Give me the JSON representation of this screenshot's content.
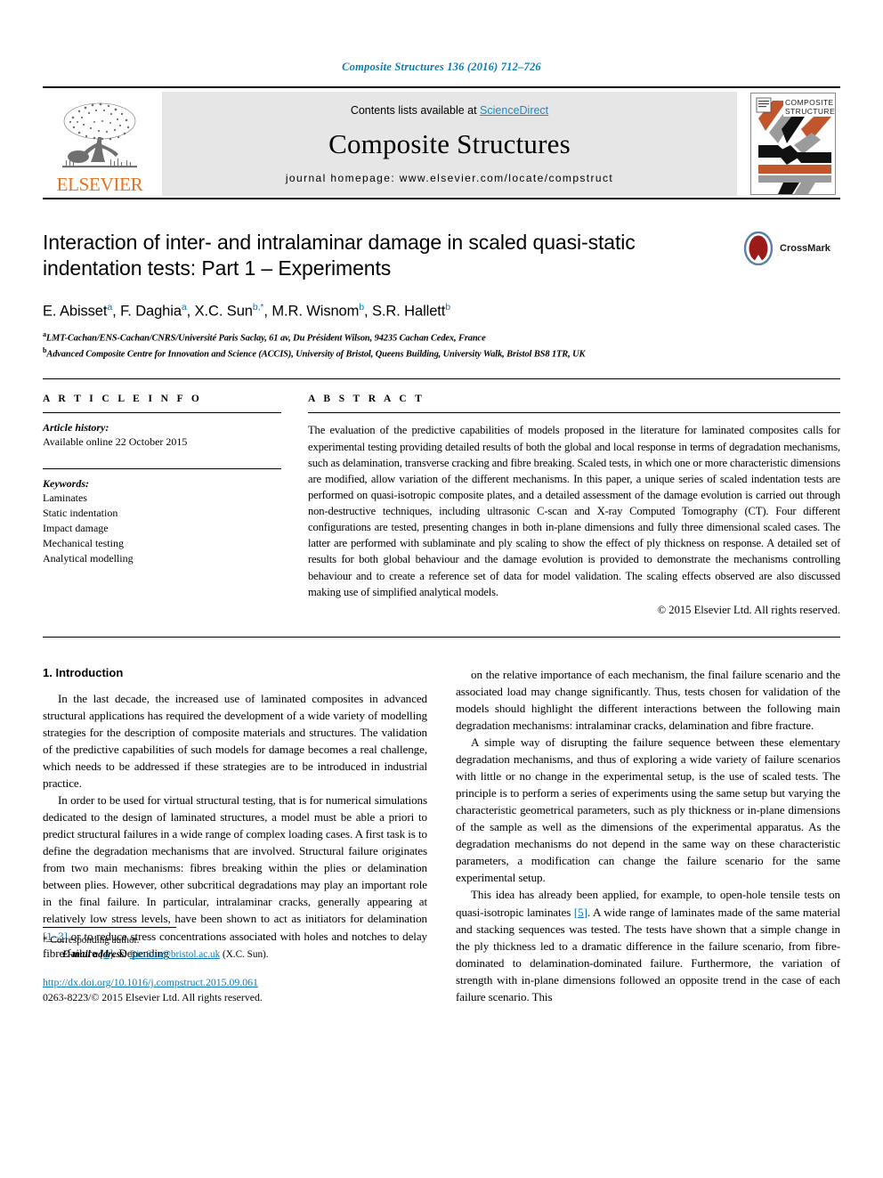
{
  "running_head": "Composite Structures 136 (2016) 712–726",
  "masthead": {
    "contents_prefix": "Contents lists available at ",
    "sciencedirect": "ScienceDirect",
    "journal_name": "Composite Structures",
    "homepage": "journal homepage: www.elsevier.com/locate/compstruct",
    "publisher_logo_text": "ELSEVIER",
    "cover_title_line1": "COMPOSITE",
    "cover_title_line2": "STRUCTURES"
  },
  "title": "Interaction of inter- and intralaminar damage in scaled quasi-static indentation tests: Part 1 – Experiments",
  "crossmark_label": "CrossMark",
  "authors": [
    {
      "name": "E. Abisset",
      "sup": "a",
      "sep": ", "
    },
    {
      "name": "F. Daghia",
      "sup": "a",
      "sep": ", "
    },
    {
      "name": "X.C. Sun",
      "sup": "b,*",
      "sep": ", "
    },
    {
      "name": "M.R. Wisnom",
      "sup": "b",
      "sep": ", "
    },
    {
      "name": "S.R. Hallett",
      "sup": "b",
      "sep": ""
    }
  ],
  "affiliations": [
    {
      "marker": "a",
      "text": "LMT-Cachan/ENS-Cachan/CNRS/Université Paris Saclay, 61 av, Du Président Wilson, 94235 Cachan Cedex, France"
    },
    {
      "marker": "b",
      "text": "Advanced Composite Centre for Innovation and Science (ACCIS), University of Bristol, Queens Building, University Walk, Bristol BS8 1TR, UK"
    }
  ],
  "article_info": {
    "heading": "A R T I C L E    I N F O",
    "history_label": "Article history:",
    "history_value": "Available online 22 October 2015",
    "keywords_label": "Keywords:",
    "keywords": [
      "Laminates",
      "Static indentation",
      "Impact damage",
      "Mechanical testing",
      "Analytical modelling"
    ]
  },
  "abstract": {
    "heading": "A B S T R A C T",
    "body": "The evaluation of the predictive capabilities of models proposed in the literature for laminated composites calls for experimental testing providing detailed results of both the global and local response in terms of degradation mechanisms, such as delamination, transverse cracking and fibre breaking. Scaled tests, in which one or more characteristic dimensions are modified, allow variation of the different mechanisms. In this paper, a unique series of scaled indentation tests are performed on quasi-isotropic composite plates, and a detailed assessment of the damage evolution is carried out through non-destructive techniques, including ultrasonic C-scan and X-ray Computed Tomography (CT). Four different configurations are tested, presenting changes in both in-plane dimensions and fully three dimensional scaled cases. The latter are performed with sublaminate and ply scaling to show the effect of ply thickness on response. A detailed set of results for both global behaviour and the damage evolution is provided to demonstrate the mechanisms controlling behaviour and to create a reference set of data for model validation. The scaling effects observed are also discussed making use of simplified analytical models.",
    "copyright": "© 2015 Elsevier Ltd. All rights reserved."
  },
  "body": {
    "section_title": "1. Introduction",
    "left_paragraphs": [
      "In the last decade, the increased use of laminated composites in advanced structural applications has required the development of a wide variety of modelling strategies for the description of composite materials and structures. The validation of the predictive capabilities of such models for damage becomes a real challenge, which needs to be addressed if these strategies are to be introduced in industrial practice.",
      "In order to be used for virtual structural testing, that is for numerical simulations dedicated to the design of laminated structures, a model must be able a priori to predict structural failures in a wide range of complex loading cases. A first task is to define the degradation mechanisms that are involved. Structural failure originates from two main mechanisms: fibres breaking within the plies or delamination between plies. However, other subcritical degradations may play an important role in the final failure. In particular, intralaminar cracks, generally appearing at relatively low stress levels, have been shown to act as initiators for delamination [1–3] or to reduce stress concentrations associated with holes and notches to delay fibre failure [4]. Depending"
    ],
    "right_paragraphs": [
      "on the relative importance of each mechanism, the final failure scenario and the associated load may change significantly. Thus, tests chosen for validation of the models should highlight the different interactions between the following main degradation mechanisms: intralaminar cracks, delamination and fibre fracture.",
      "A simple way of disrupting the failure sequence between these elementary degradation mechanisms, and thus of exploring a wide variety of failure scenarios with little or no change in the experimental setup, is the use of scaled tests. The principle is to perform a series of experiments using the same setup but varying the characteristic geometrical parameters, such as ply thickness or in-plane dimensions of the sample as well as the dimensions of the experimental apparatus. As the degradation mechanisms do not depend in the same way on these characteristic parameters, a modification can change the failure scenario for the same experimental setup.",
      "This idea has already been applied, for example, to open-hole tensile tests on quasi-isotropic laminates [5]. A wide range of laminates made of the same material and stacking sequences was tested. The tests have shown that a simple change in the ply thickness led to a dramatic difference in the failure scenario, from fibre-dominated to delamination-dominated failure. Furthermore, the variation of strength with in-plane dimensions followed an opposite trend in the case of each failure scenario. This"
    ],
    "citations_left": [
      "[1–3]",
      "[4]"
    ],
    "citations_right": [
      "[5]"
    ]
  },
  "footnotes": {
    "corresponding_marker": "*",
    "corresponding_text": "Corresponding author.",
    "email_label": "E-mail address:",
    "email_value": "Ric.Sun@bristol.ac.uk",
    "email_owner": "(X.C. Sun).",
    "doi": "http://dx.doi.org/10.1016/j.compstruct.2015.09.061",
    "issn": "0263-8223/© 2015 Elsevier Ltd. All rights reserved."
  },
  "colors": {
    "link_blue": "#0b7ab5",
    "sciencedirect_blue": "#1a8ac4",
    "elsevier_orange": "#E9711C",
    "cover_orange": "#C1562C",
    "cover_grey": "#9B9B9B",
    "masthead_grey": "#e6e6e6"
  }
}
